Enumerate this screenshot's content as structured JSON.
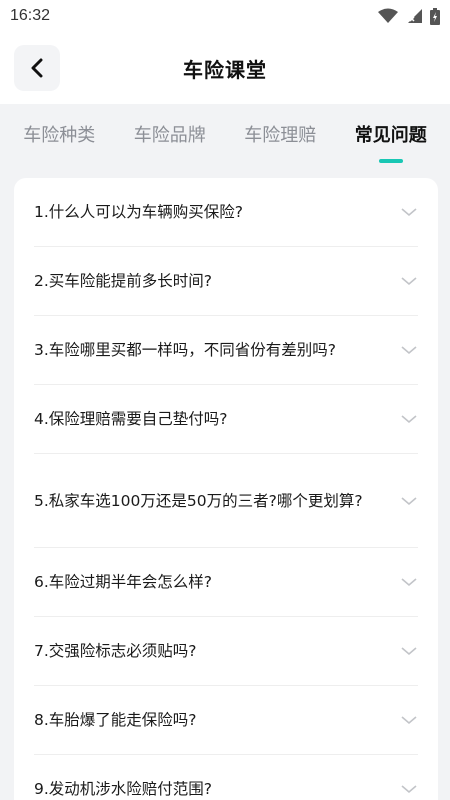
{
  "status": {
    "time": "16:32"
  },
  "header": {
    "title": "车险课堂"
  },
  "tabs": [
    {
      "label": "车险种类",
      "active": false
    },
    {
      "label": "车险品牌",
      "active": false
    },
    {
      "label": "车险理赔",
      "active": false
    },
    {
      "label": "常见问题",
      "active": true
    }
  ],
  "faq": [
    {
      "question": "1.什么人可以为车辆购买保险?"
    },
    {
      "question": "2.买车险能提前多长时间?"
    },
    {
      "question": "3.车险哪里买都一样吗，不同省份有差别吗?"
    },
    {
      "question": "4.保险理赔需要自己垫付吗?"
    },
    {
      "question": "5.私家车选100万还是50万的三者?哪个更划算?"
    },
    {
      "question": "6.车险过期半年会怎么样?"
    },
    {
      "question": "7.交强险标志必须贴吗?"
    },
    {
      "question": "8.车胎爆了能走保险吗?"
    },
    {
      "question": "9.发动机涉水险赔付范围?"
    }
  ],
  "colors": {
    "accent": "#19c7b4",
    "background": "#f2f3f5"
  },
  "icons": {
    "back": "back-arrow-icon",
    "expand": "chevron-down-icon"
  }
}
